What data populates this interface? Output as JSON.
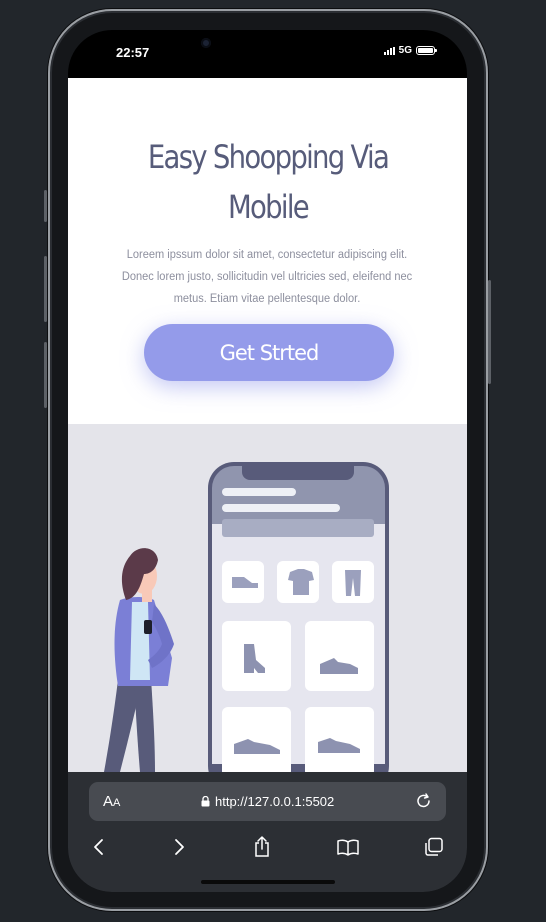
{
  "status_bar": {
    "time": "22:57",
    "network": "5G"
  },
  "page": {
    "title_line1": "Easy Shoopping Via",
    "title_line2": "Mobile",
    "description": "Loreem ipssum dolor sit amet, consectetur adipiscing elit. Donec lorem justo, sollicitudin vel ultricies sed, eleifend nec metus. Etiam vitae pellentesque dolor.",
    "cta_label": "Get Strted"
  },
  "browser": {
    "text_size_label_big": "A",
    "text_size_label_small": "A",
    "url": "http://127.0.0.1:5502"
  },
  "icons": [
    "camera-icon",
    "signal-icon",
    "battery-icon",
    "lock-icon",
    "reload-icon",
    "back-icon",
    "forward-icon",
    "share-icon",
    "bookmarks-icon",
    "tabs-icon"
  ],
  "colors": {
    "accent": "#949bea",
    "title": "#575c7a",
    "illustration_bg": "#e4e4ea",
    "phone_frame": "#585b7a"
  }
}
